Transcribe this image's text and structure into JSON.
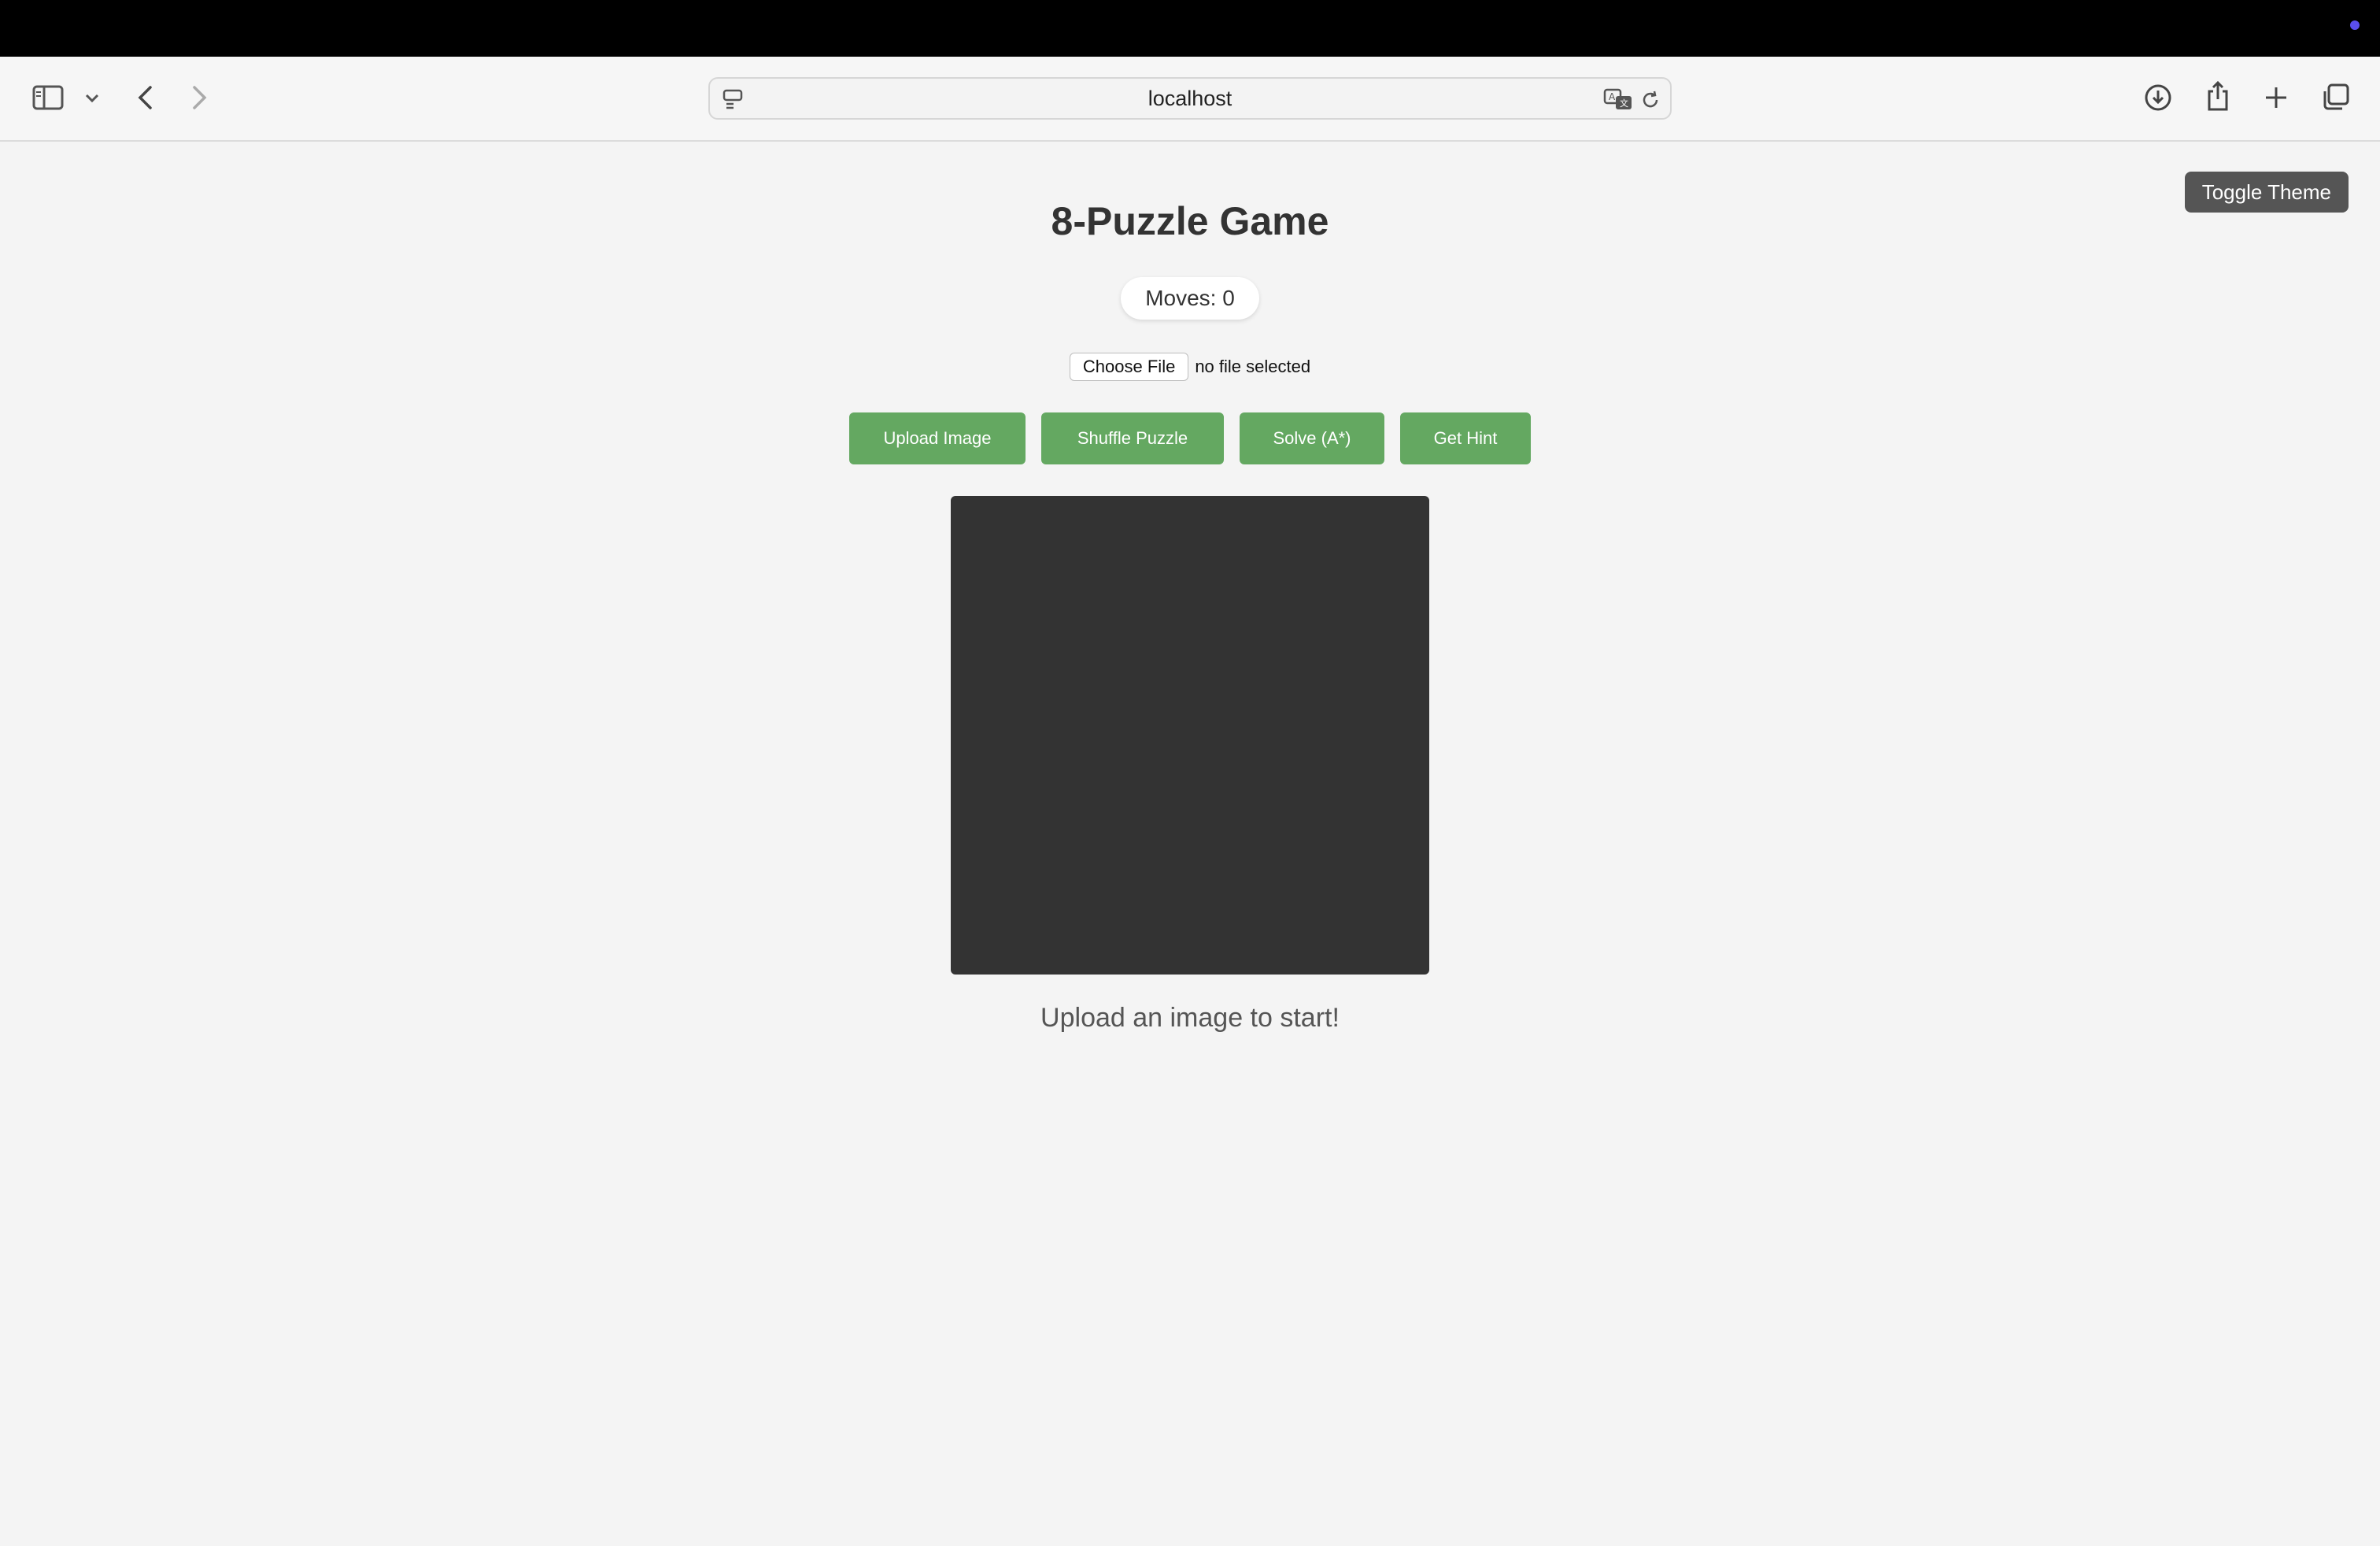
{
  "browser": {
    "url": "localhost",
    "icons": {
      "sidebar": "sidebar-icon",
      "sidebar_menu": "chevron-down-icon",
      "back": "back-arrow-icon",
      "forward": "forward-arrow-icon",
      "page_menu": "page-menu-icon",
      "translate": "translate-icon",
      "reload": "reload-icon",
      "downloads": "download-icon",
      "share": "share-icon",
      "new_tab": "plus-icon",
      "tab_overview": "tabs-icon"
    }
  },
  "page": {
    "theme_toggle_label": "Toggle Theme",
    "title": "8-Puzzle Game",
    "moves_text": "Moves: 0",
    "file_input": {
      "button_label": "Choose File",
      "status": "no file selected"
    },
    "actions": {
      "upload": "Upload Image",
      "shuffle": "Shuffle Puzzle",
      "solve": "Solve (A*)",
      "hint": "Get Hint"
    },
    "status_message": "Upload an image to start!"
  },
  "colors": {
    "accent_green": "#64a861",
    "board_bg": "#333333",
    "theme_button_bg": "#555555",
    "page_bg": "#f4f4f4"
  }
}
